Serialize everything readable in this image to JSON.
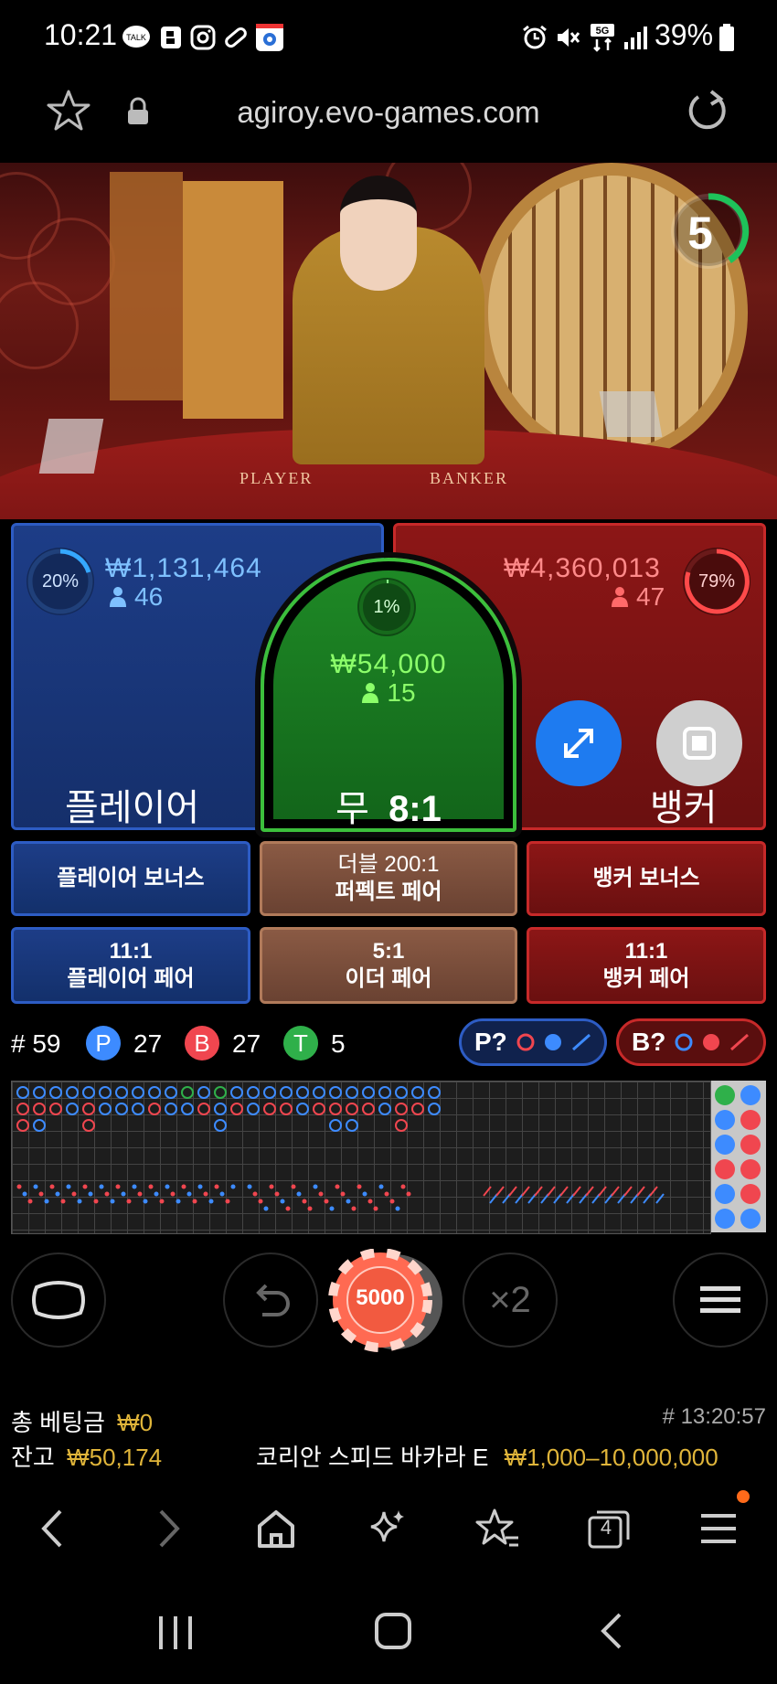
{
  "status_bar": {
    "time": "10:21",
    "battery": "39%",
    "icons_left": [
      "talk-icon",
      "b-icon",
      "instagram-icon",
      "pill-icon",
      "app-icon"
    ],
    "icons_right": [
      "alarm-icon",
      "mute-icon",
      "5g-icon",
      "signal-icon",
      "battery-icon"
    ],
    "talk_label": "TALK",
    "net_label": "5G"
  },
  "browser": {
    "url": "agiroy.evo-games.com"
  },
  "video": {
    "timer": "5",
    "table_player_text": "PLAYER",
    "table_banker_text": "BANKER"
  },
  "bets": {
    "player": {
      "label": "플레이어",
      "amount": "₩1,131,464",
      "players": "46",
      "percent": "20%",
      "percent_value": 20
    },
    "banker": {
      "label": "뱅커",
      "amount": "₩4,360,013",
      "players": "47",
      "percent": "79%",
      "percent_value": 79
    },
    "tie": {
      "label": "무",
      "odds": "8:1",
      "amount": "₩54,000",
      "players": "15",
      "percent": "1%",
      "percent_value": 1
    }
  },
  "side_bets": {
    "player_bonus": "플레이어 보너스",
    "perfect_pair_line1": "더블 200:1",
    "perfect_pair_line2": "퍼펙트 페어",
    "banker_bonus": "뱅커 보너스",
    "player_pair_line1": "11:1",
    "player_pair_line2": "플레이어 페어",
    "either_pair_line1": "5:1",
    "either_pair_line2": "이더 페어",
    "banker_pair_line1": "11:1",
    "banker_pair_line2": "뱅커 페어"
  },
  "stats": {
    "round": "# 59",
    "player_letter": "P",
    "player_count": "27",
    "banker_letter": "B",
    "banker_count": "27",
    "tie_letter": "T",
    "tie_count": "5",
    "p_predict": "P?",
    "b_predict": "B?"
  },
  "colors": {
    "player_blue": "#3d8bff",
    "banker_red": "#f0464f",
    "tie_green": "#2fb04a",
    "accent_blue": "#1e7bf0"
  },
  "controls": {
    "chip_value": "5000",
    "double_label": "×2"
  },
  "footer": {
    "total_bet_label": "총 베팅금",
    "total_bet_value": "₩0",
    "balance_label": "잔고",
    "balance_value": "₩50,174",
    "game_id": "# 13:20:57",
    "table_name": "코리안 스피드 바카라 E",
    "limits": "₩1,000–10,000,000"
  },
  "browser_nav": {
    "tabs_count": "4"
  }
}
